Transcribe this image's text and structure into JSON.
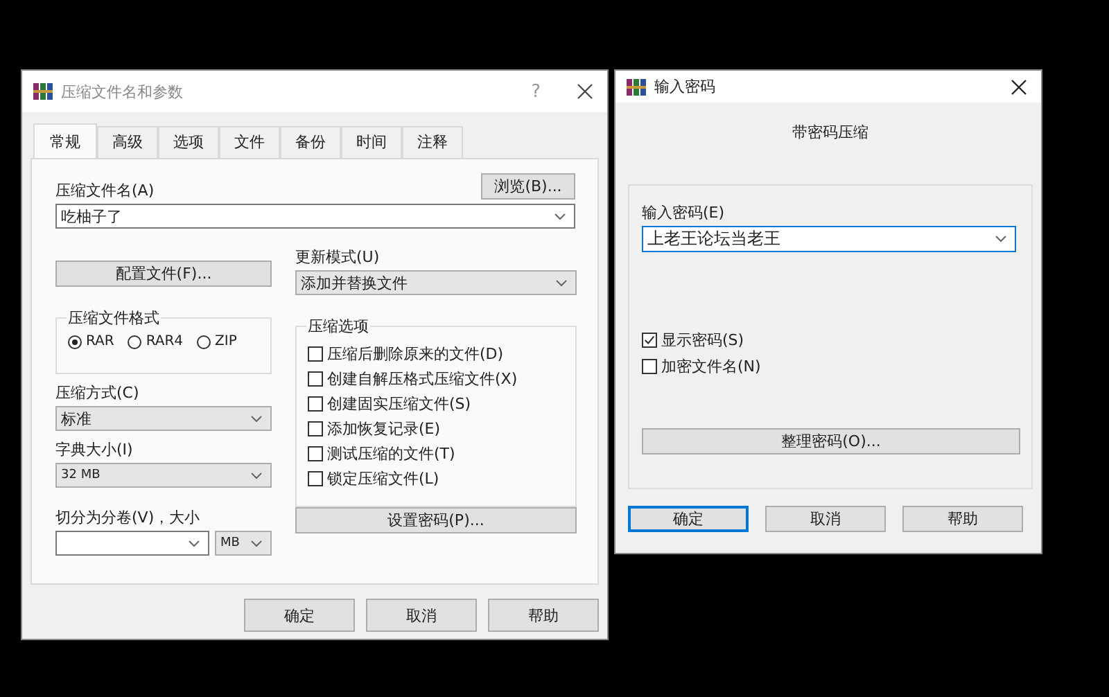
{
  "main_dialog": {
    "title": "压缩文件名和参数",
    "help_glyph": "?",
    "tabs": [
      {
        "label": "常规",
        "selected": true
      },
      {
        "label": "高级",
        "selected": false
      },
      {
        "label": "选项",
        "selected": false
      },
      {
        "label": "文件",
        "selected": false
      },
      {
        "label": "备份",
        "selected": false
      },
      {
        "label": "时间",
        "selected": false
      },
      {
        "label": "注释",
        "selected": false
      }
    ],
    "archive_name": {
      "label": "压缩文件名(A)",
      "value": "吃柚子了"
    },
    "browse_button": "浏览(B)...",
    "profiles_button": "配置文件(F)...",
    "update_mode": {
      "label": "更新模式(U)",
      "value": "添加并替换文件"
    },
    "archive_format": {
      "title": "压缩文件格式",
      "options": [
        {
          "label": "RAR",
          "selected": true
        },
        {
          "label": "RAR4",
          "selected": false
        },
        {
          "label": "ZIP",
          "selected": false
        }
      ]
    },
    "method": {
      "label": "压缩方式(C)",
      "value": "标准"
    },
    "dictionary": {
      "label": "字典大小(I)",
      "value": "32 MB"
    },
    "split": {
      "label": "切分为分卷(V)，大小",
      "unit": "MB"
    },
    "options": {
      "title": "压缩选项",
      "items": [
        {
          "label": "压缩后删除原来的文件(D)",
          "checked": false
        },
        {
          "label": "创建自解压格式压缩文件(X)",
          "checked": false
        },
        {
          "label": "创建固实压缩文件(S)",
          "checked": false
        },
        {
          "label": "添加恢复记录(E)",
          "checked": false
        },
        {
          "label": "测试压缩的文件(T)",
          "checked": false
        },
        {
          "label": "锁定压缩文件(L)",
          "checked": false
        }
      ]
    },
    "password_button": "设置密码(P)...",
    "buttons": [
      {
        "label": "确定",
        "default": false
      },
      {
        "label": "取消",
        "default": false
      },
      {
        "label": "帮助",
        "default": false
      }
    ]
  },
  "password_dialog": {
    "title": "输入密码",
    "heading": "带密码压缩",
    "password": {
      "label": "输入密码(E)",
      "value": "上老王论坛当老王"
    },
    "options": [
      {
        "label": "显示密码(S)",
        "checked": true
      },
      {
        "label": "加密文件名(N)",
        "checked": false
      }
    ],
    "organize_button": "整理密码(O)...",
    "buttons": [
      {
        "label": "确定",
        "default": true
      },
      {
        "label": "取消",
        "default": false
      },
      {
        "label": "帮助",
        "default": false
      }
    ]
  }
}
